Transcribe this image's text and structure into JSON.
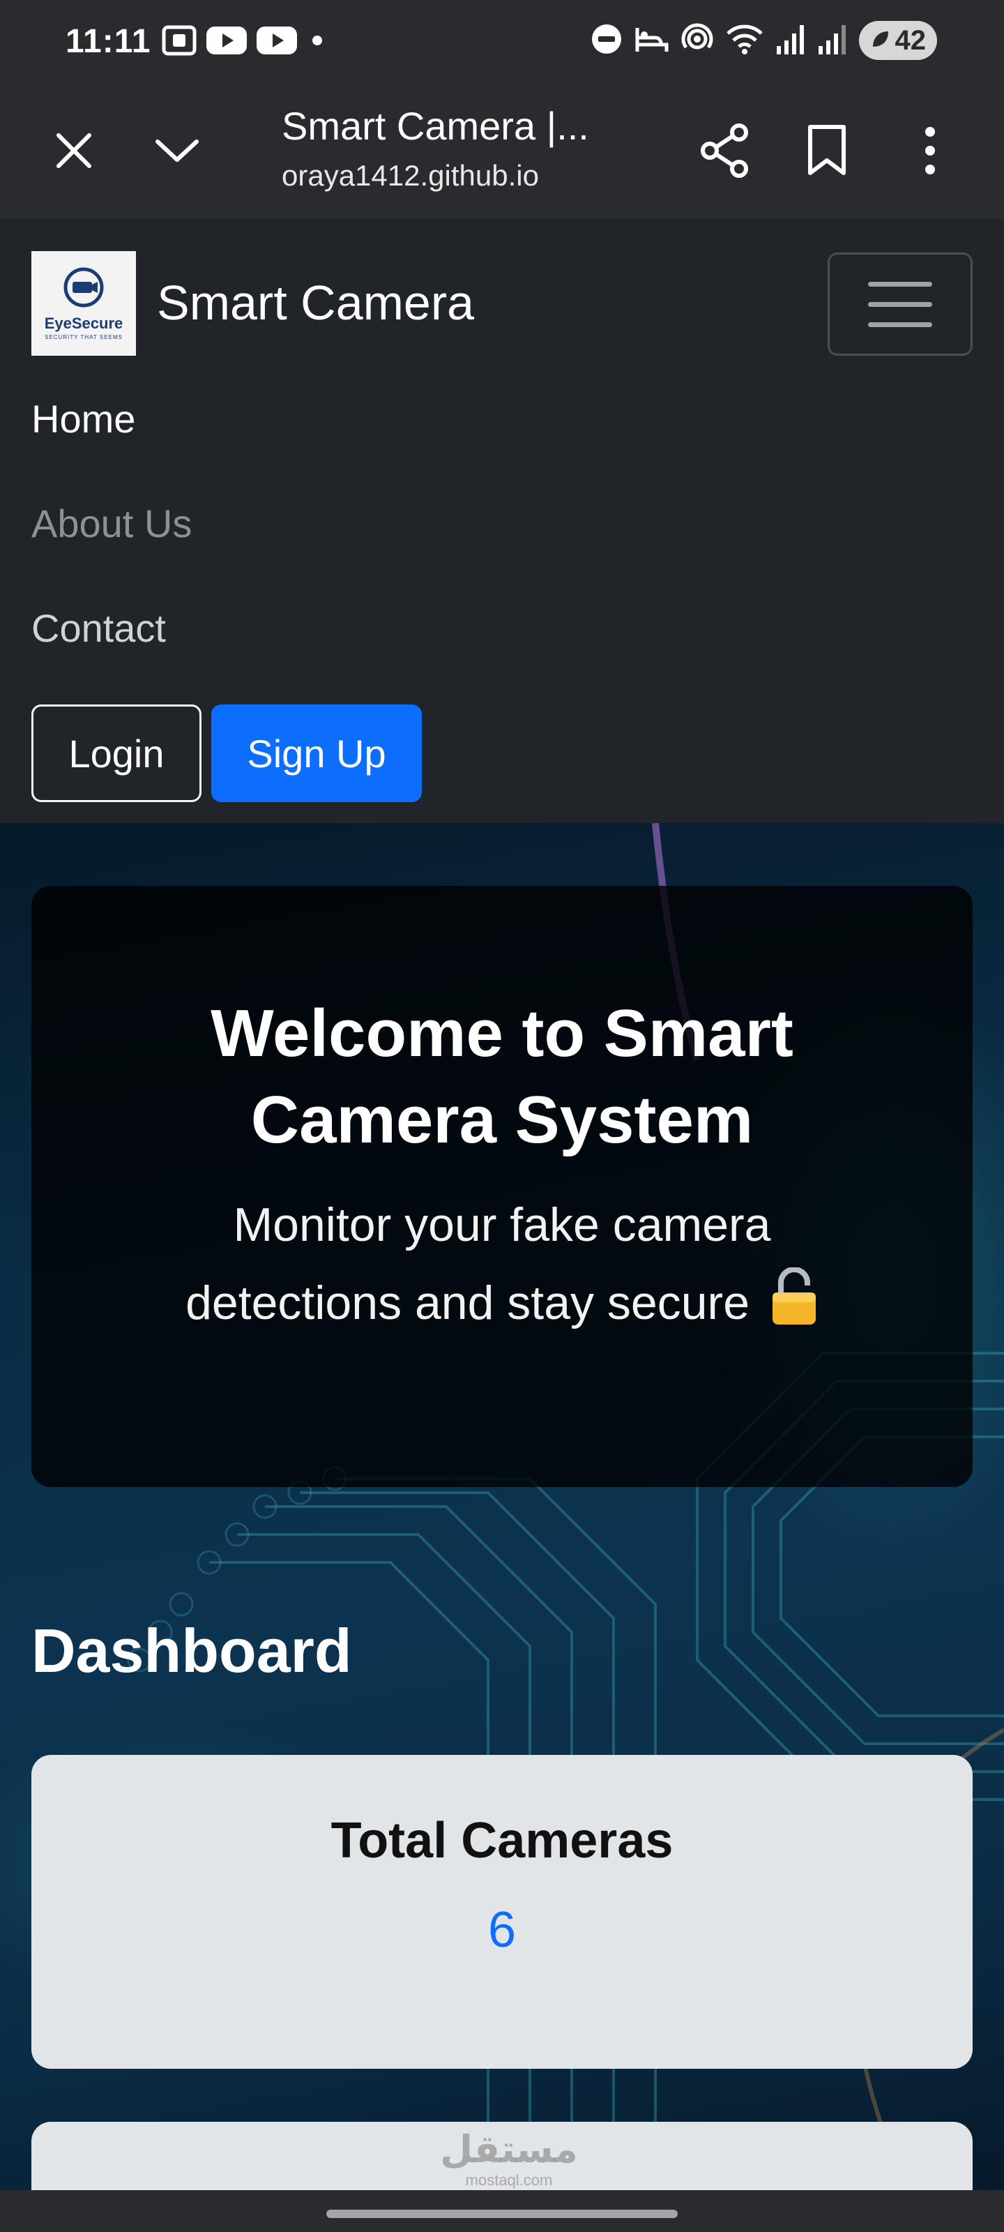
{
  "status_bar": {
    "time": "11:11",
    "battery_level": "42",
    "icons": [
      "screenshot-icon",
      "youtube-icon",
      "youtube-icon",
      "dot-icon",
      "dnd-icon",
      "sleep-icon",
      "hotspot-icon",
      "wifi-icon",
      "signal-icon",
      "signal-icon",
      "battery-icon"
    ]
  },
  "browser": {
    "title": "Smart Camera |...",
    "url": "oraya1412.github.io",
    "icons": [
      "close-icon",
      "chevron-down-icon",
      "share-icon",
      "bookmark-icon",
      "more-vert-icon"
    ]
  },
  "navbar": {
    "logo_text": "EyeSecure",
    "logo_subtext": "SECURITY THAT SEEMS",
    "brand": "Smart Camera",
    "links": [
      {
        "label": "Home"
      },
      {
        "label": "About Us"
      },
      {
        "label": "Contact"
      }
    ],
    "login_label": "Login",
    "signup_label": "Sign Up"
  },
  "hero": {
    "title": "Welcome to Smart Camera System",
    "subtitle": "Monitor your fake camera detections and stay secure",
    "subtitle_icon": "lock-icon"
  },
  "dashboard": {
    "title": "Dashboard",
    "cards": [
      {
        "label": "Total Cameras",
        "value": "6"
      }
    ]
  },
  "watermark": {
    "text": "مستقل",
    "subtext": "mostaql.com"
  },
  "colors": {
    "primary": "#0d6efd",
    "navbar_bg": "#212529",
    "chrome_bg": "#2a2b2f",
    "card_bg": "#e2e5e8"
  }
}
